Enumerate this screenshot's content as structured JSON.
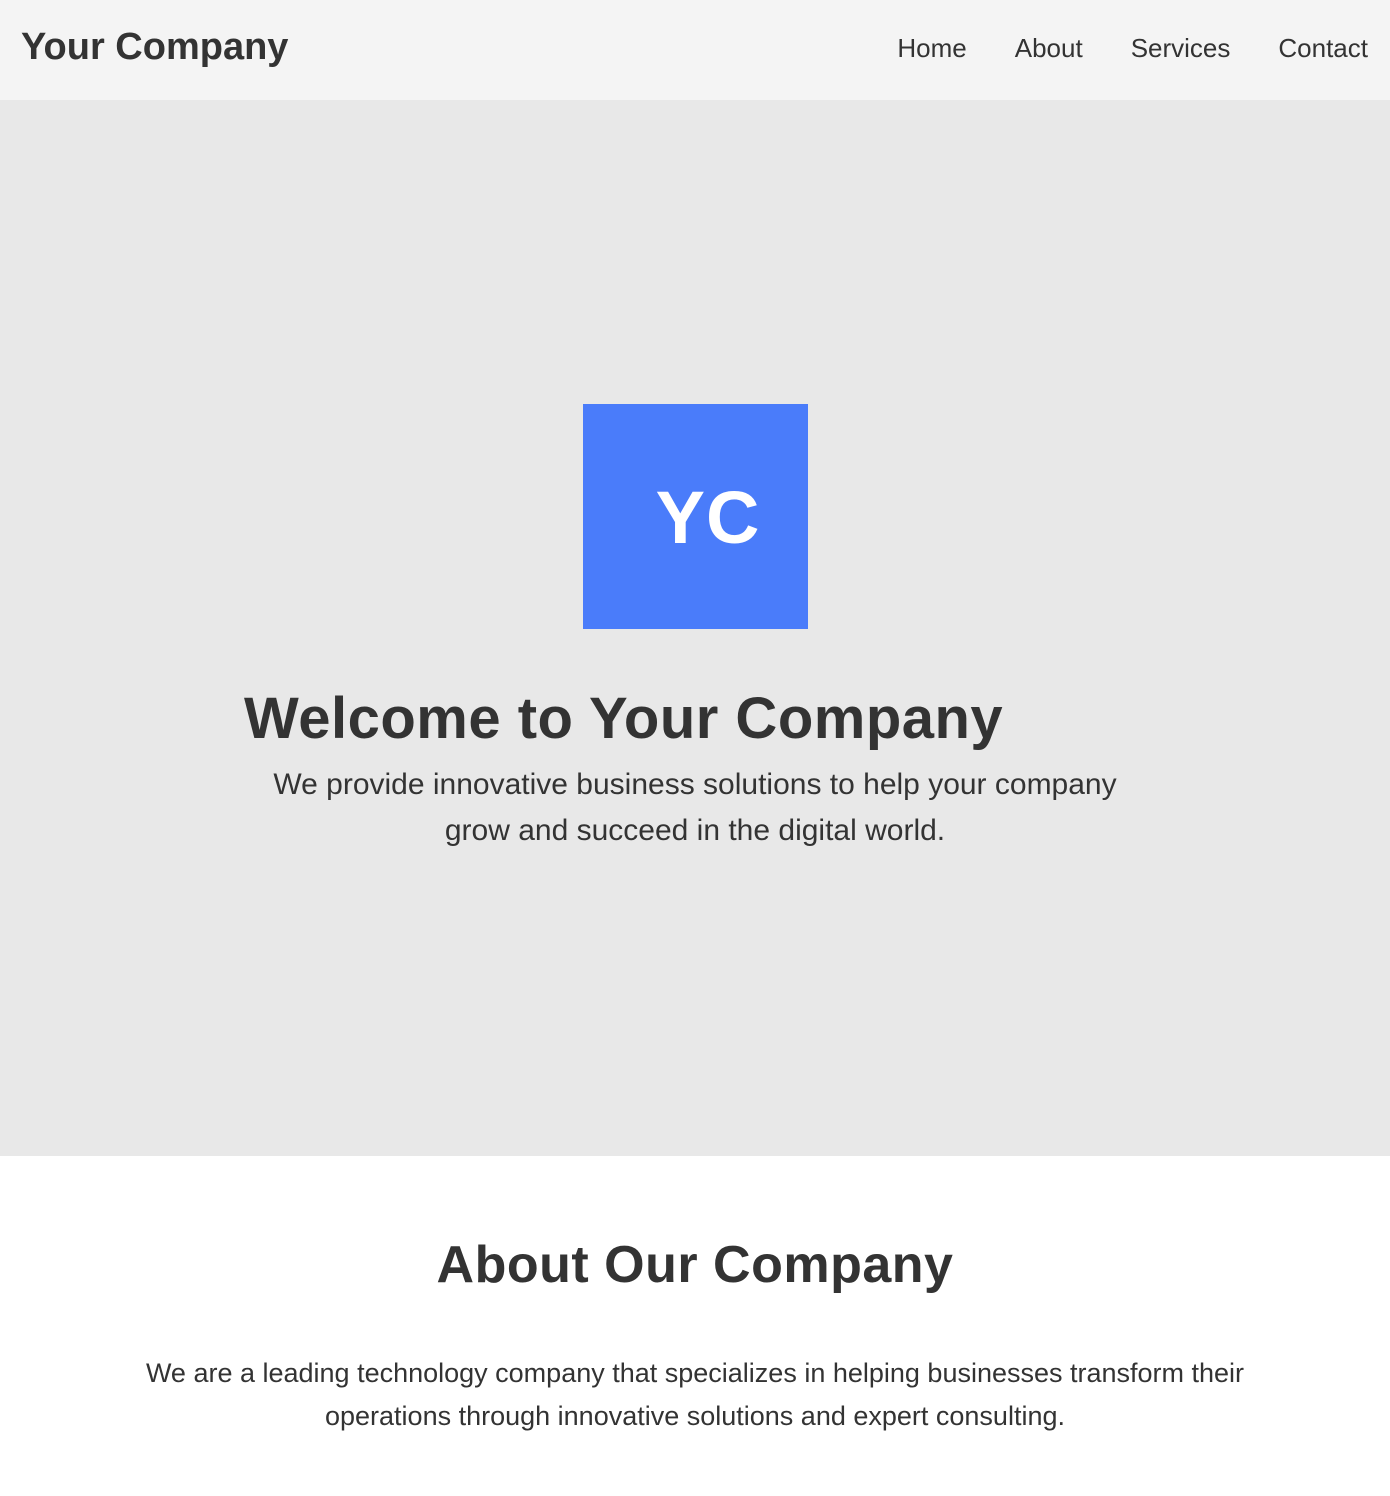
{
  "header": {
    "brand": "Your Company",
    "nav": [
      {
        "label": "Home"
      },
      {
        "label": "About"
      },
      {
        "label": "Services"
      },
      {
        "label": "Contact"
      }
    ]
  },
  "hero": {
    "logo_text": "YC",
    "title": "Welcome to Your Company",
    "text": "We provide innovative business solutions to help your company grow and succeed in the digital world."
  },
  "about": {
    "title": "About Our Company",
    "text": "We are a leading technology company that specializes in helping businesses transform their operations through innovative solutions and expert consulting."
  },
  "colors": {
    "header_bg": "#f4f4f4",
    "hero_bg": "#e8e8e8",
    "logo_bg": "#4a7cfa",
    "text": "#333333"
  }
}
